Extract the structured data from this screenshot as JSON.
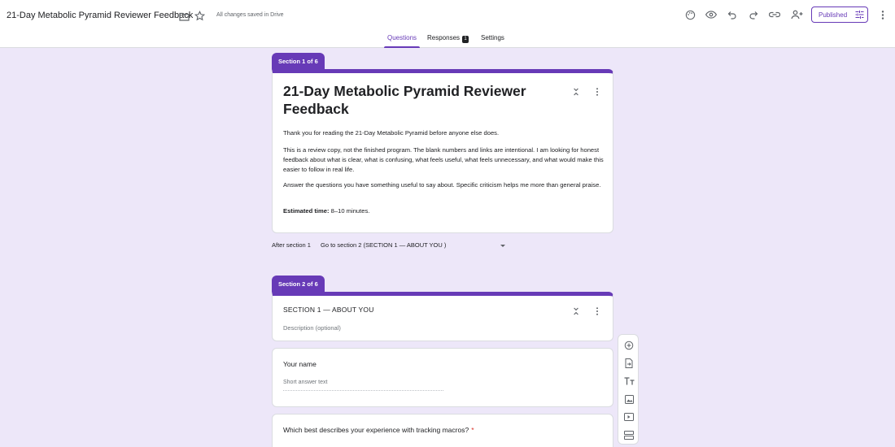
{
  "header": {
    "title": "21-Day Metabolic Pyramid Reviewer Feedback",
    "saved_status": "All changes saved in Drive",
    "publish_label": "Published",
    "icons": [
      "folder-icon",
      "star-icon",
      "palette-icon",
      "eye-icon",
      "undo-icon",
      "redo-icon",
      "link-icon",
      "add-person-icon",
      "tune-icon",
      "more-vert-icon"
    ]
  },
  "tabs": {
    "questions": "Questions",
    "responses": "Responses",
    "responses_count": "1",
    "settings": "Settings"
  },
  "section1": {
    "tab_label": "Section 1 of 6",
    "title": "21-Day Metabolic Pyramid Reviewer Feedback",
    "para1": "Thank you for reading the 21-Day Metabolic Pyramid before anyone else does.",
    "para2": "This is a review copy, not the finished program. The blank numbers and links are intentional. I am looking for honest feedback about what is clear, what is confusing, what feels useful, what feels unnecessary, and what would make this easier to follow in real life.",
    "para3": "Answer the questions you have something useful to say about. Specific criticism helps me more than general praise.",
    "time_label": "Estimated time:",
    "time_value": "8–10 minutes."
  },
  "after_section": {
    "label": "After section 1",
    "value": "Go to section 2 (SECTION 1 — ABOUT YOU )"
  },
  "section2": {
    "tab_label": "Section 2 of 6",
    "title": "SECTION 1 — ABOUT YOU",
    "description_placeholder": "Description (optional)"
  },
  "questions": [
    {
      "label": "Your name",
      "placeholder": "Short answer text",
      "required": false
    },
    {
      "label": "Which best describes your experience with tracking macros?",
      "required": true,
      "required_mark": "*"
    }
  ],
  "toolbar": {
    "items": [
      "add-question-icon",
      "import-questions-icon",
      "add-title-icon",
      "add-image-icon",
      "add-video-icon",
      "add-section-icon"
    ]
  },
  "colors": {
    "accent": "#673ab7",
    "background": "#ede7f9",
    "required": "#d93025"
  }
}
